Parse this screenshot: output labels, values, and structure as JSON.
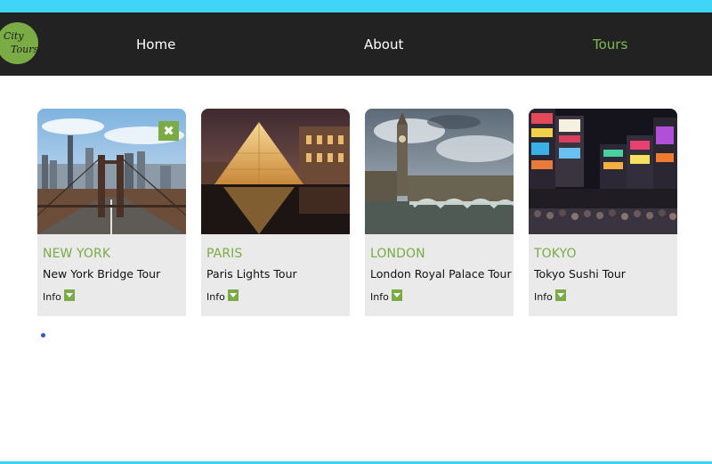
{
  "brand": {
    "logo_line1": "City",
    "logo_line2": "Tours"
  },
  "nav": {
    "home": "Home",
    "about": "About",
    "tours": "Tours",
    "active": "tours"
  },
  "tours": [
    {
      "city": "NEW YORK",
      "tour": "New York Bridge Tour",
      "info": "Info",
      "close": "✖",
      "image": "brooklyn-bridge-photo"
    },
    {
      "city": "PARIS",
      "tour": "Paris Lights Tour",
      "info": "Info",
      "image": "louvre-pyramid-photo"
    },
    {
      "city": "LONDON",
      "tour": "London Royal Palace Tour",
      "info": "Info",
      "image": "big-ben-photo"
    },
    {
      "city": "TOKYO",
      "tour": "Tokyo Sushi Tour",
      "info": "Info",
      "image": "tokyo-night-street-photo"
    }
  ],
  "colors": {
    "accent": "#7aab44",
    "nav_bg": "#222222",
    "top_strip": "#3fd3f6",
    "card_bg": "#eaeaea"
  }
}
